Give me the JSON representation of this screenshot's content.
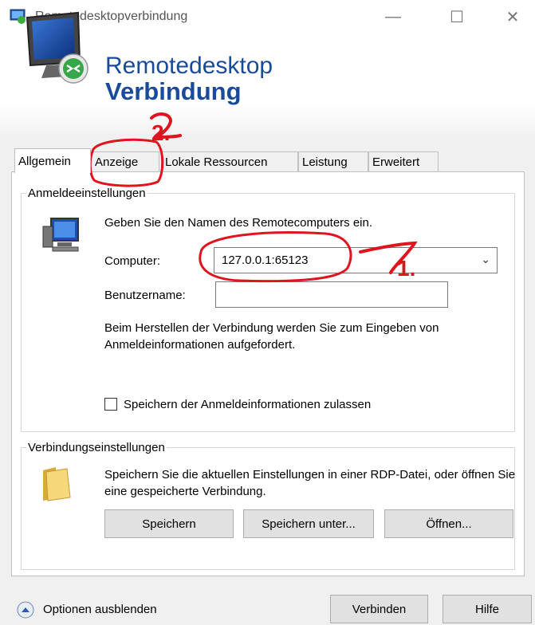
{
  "window": {
    "title": "Remotedesktopverbindung",
    "minimize": "—",
    "maximize": "☐",
    "close": "✕"
  },
  "banner": {
    "line1": "Remotedesktop",
    "line2": "Verbindung",
    "brand_color": "#1a4b9b"
  },
  "tabs": [
    {
      "label": "Allgemein",
      "active": true
    },
    {
      "label": "Anzeige",
      "active": false
    },
    {
      "label": "Lokale Ressourcen",
      "active": false
    },
    {
      "label": "Leistung",
      "active": false
    },
    {
      "label": "Erweitert",
      "active": false
    }
  ],
  "login": {
    "legend": "Anmeldeeinstellungen",
    "intro": "Geben Sie den Namen des Remotecomputers ein.",
    "computer_label": "Computer:",
    "computer_value": "127.0.0.1:65123",
    "user_label": "Benutzername:",
    "user_value": "",
    "note": "Beim Herstellen der Verbindung werden Sie zum Eingeben von Anmeldeinformationen aufgefordert.",
    "save_credentials_label": "Speichern der Anmeldeinformationen zulassen",
    "save_credentials_checked": false
  },
  "connection": {
    "legend": "Verbindungseinstellungen",
    "note": "Speichern Sie die aktuellen Einstellungen in einer RDP-Datei, oder öffnen Sie eine gespeicherte Verbindung.",
    "save_label": "Speichern",
    "save_as_label": "Speichern unter...",
    "open_label": "Öffnen..."
  },
  "footer": {
    "options_label": "Optionen ausblenden",
    "connect_label": "Verbinden",
    "help_label": "Hilfe"
  },
  "annotations": {
    "step1": "1.",
    "step2": "2.",
    "color": "#e0141e"
  }
}
